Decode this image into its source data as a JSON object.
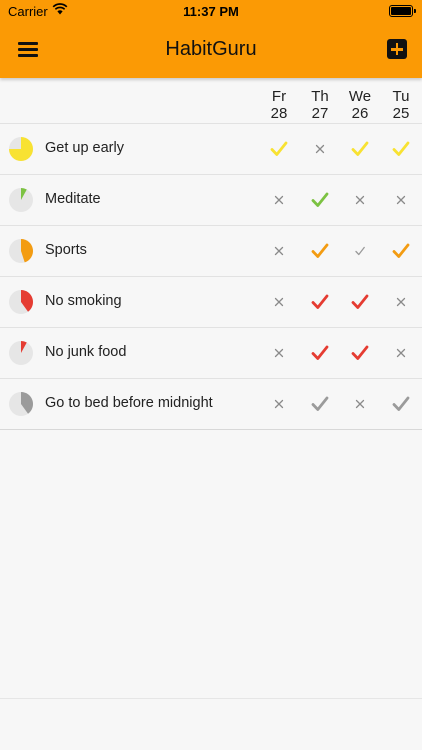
{
  "status_bar": {
    "carrier": "Carrier",
    "time": "11:37 PM"
  },
  "header": {
    "title": "HabitGuru",
    "menu_icon": "hamburger-icon",
    "add_icon": "plus-square-icon"
  },
  "days": [
    {
      "dow": "Fr",
      "date": "28"
    },
    {
      "dow": "Th",
      "date": "27"
    },
    {
      "dow": "We",
      "date": "26"
    },
    {
      "dow": "Tu",
      "date": "25"
    }
  ],
  "habits": [
    {
      "name": "Get up early",
      "color": "#f8e232",
      "progress": 0.75,
      "entries": [
        "done",
        "missed",
        "done",
        "done"
      ]
    },
    {
      "name": "Meditate",
      "color": "#7cc242",
      "progress": 0.08,
      "entries": [
        "missed",
        "done",
        "missed",
        "missed"
      ]
    },
    {
      "name": "Sports",
      "color": "#f39c12",
      "progress": 0.45,
      "entries": [
        "missed",
        "done",
        "skipped",
        "done"
      ]
    },
    {
      "name": "No smoking",
      "color": "#e53c32",
      "progress": 0.4,
      "entries": [
        "missed",
        "done",
        "done",
        "missed"
      ]
    },
    {
      "name": "No junk food",
      "color": "#e53c32",
      "progress": 0.08,
      "entries": [
        "missed",
        "done",
        "done",
        "missed"
      ]
    },
    {
      "name": "Go to bed before midnight",
      "color": "#9b9b9b",
      "progress": 0.4,
      "entries": [
        "missed",
        "done",
        "missed",
        "done"
      ]
    }
  ]
}
